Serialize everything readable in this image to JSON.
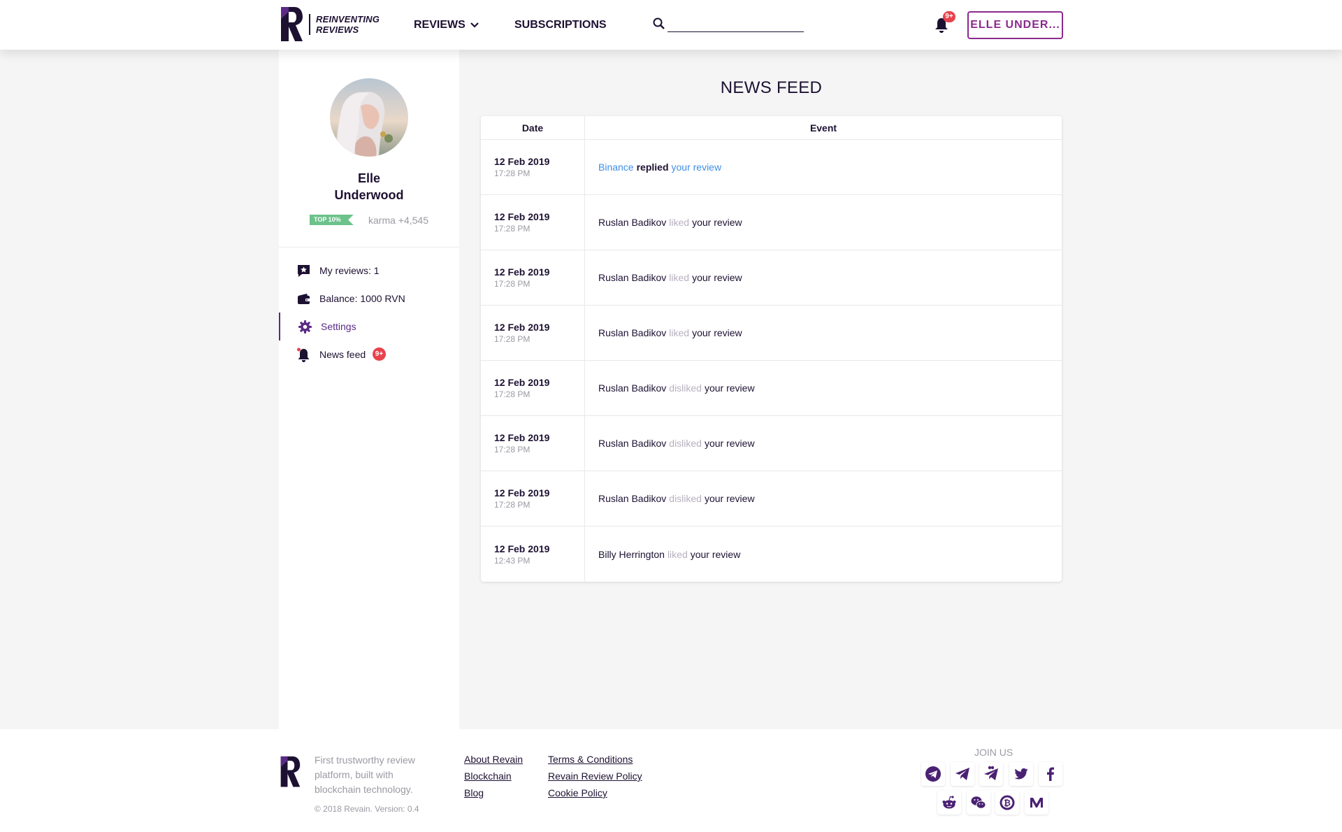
{
  "header": {
    "tagline_line1": "REINVENTING",
    "tagline_line2": "REVIEWS",
    "nav_reviews": "REVIEWS",
    "nav_subscriptions": "SUBSCRIPTIONS",
    "search_value": "",
    "notification_count": "9+",
    "user_button": "ELLE UNDER..."
  },
  "profile": {
    "first_name": "Elle",
    "last_name": "Underwood",
    "rank_badge": "TOP 10%",
    "karma": "karma +4,545"
  },
  "sidebar": {
    "items": [
      {
        "label": "My reviews: 1",
        "icon": "star-chat-icon"
      },
      {
        "label": "Balance: 1000 RVN",
        "icon": "wallet-icon"
      },
      {
        "label": "Settings",
        "icon": "gear-icon",
        "active": true
      },
      {
        "label": "News feed",
        "icon": "bell-icon",
        "badge": "9+"
      }
    ]
  },
  "main": {
    "title": "NEWS FEED",
    "columns": {
      "date": "Date",
      "event": "Event"
    },
    "rows": [
      {
        "date": "12 Feb 2019",
        "time": "17:28 PM",
        "actor": "Binance",
        "verb": "replied",
        "target": "your review",
        "highlight": true
      },
      {
        "date": "12 Feb 2019",
        "time": "17:28 PM",
        "actor": "Ruslan Badikov",
        "verb": "liked",
        "target": "your review"
      },
      {
        "date": "12 Feb 2019",
        "time": "17:28 PM",
        "actor": "Ruslan Badikov",
        "verb": "liked",
        "target": "your review"
      },
      {
        "date": "12 Feb 2019",
        "time": "17:28 PM",
        "actor": "Ruslan Badikov",
        "verb": "liked",
        "target": "your review"
      },
      {
        "date": "12 Feb 2019",
        "time": "17:28 PM",
        "actor": "Ruslan Badikov",
        "verb": "disliked",
        "target": "your review"
      },
      {
        "date": "12 Feb 2019",
        "time": "17:28 PM",
        "actor": "Ruslan Badikov",
        "verb": "disliked",
        "target": "your review"
      },
      {
        "date": "12 Feb 2019",
        "time": "17:28 PM",
        "actor": "Ruslan Badikov",
        "verb": "disliked",
        "target": "your review"
      },
      {
        "date": "12 Feb 2019",
        "time": "12:43 PM",
        "actor": "Billy Herrington",
        "verb": "liked",
        "target": "your review"
      }
    ]
  },
  "footer": {
    "description": "First trustworthy review platform, built with blockchain technology.",
    "copyright": "© 2018 Revain. Version: 0.4",
    "links_col1": [
      "About Revain",
      "Blockchain",
      "Blog"
    ],
    "links_col2": [
      "Terms & Conditions",
      "Revain Review Policy",
      "Cookie Policy"
    ],
    "join_label": "JOIN US",
    "socials": [
      "telegram-circle-icon",
      "telegram-icon",
      "telegram-chat-icon",
      "twitter-icon",
      "facebook-icon",
      "reddit-icon",
      "wechat-icon",
      "bitcointalk-icon",
      "medium-icon"
    ]
  },
  "colors": {
    "brand_dark": "#1d1132",
    "accent_purple": "#8b2a8e",
    "link_blue": "#3f8fe6",
    "badge_red": "#e8434d",
    "top_badge_green": "#6cc28b"
  }
}
